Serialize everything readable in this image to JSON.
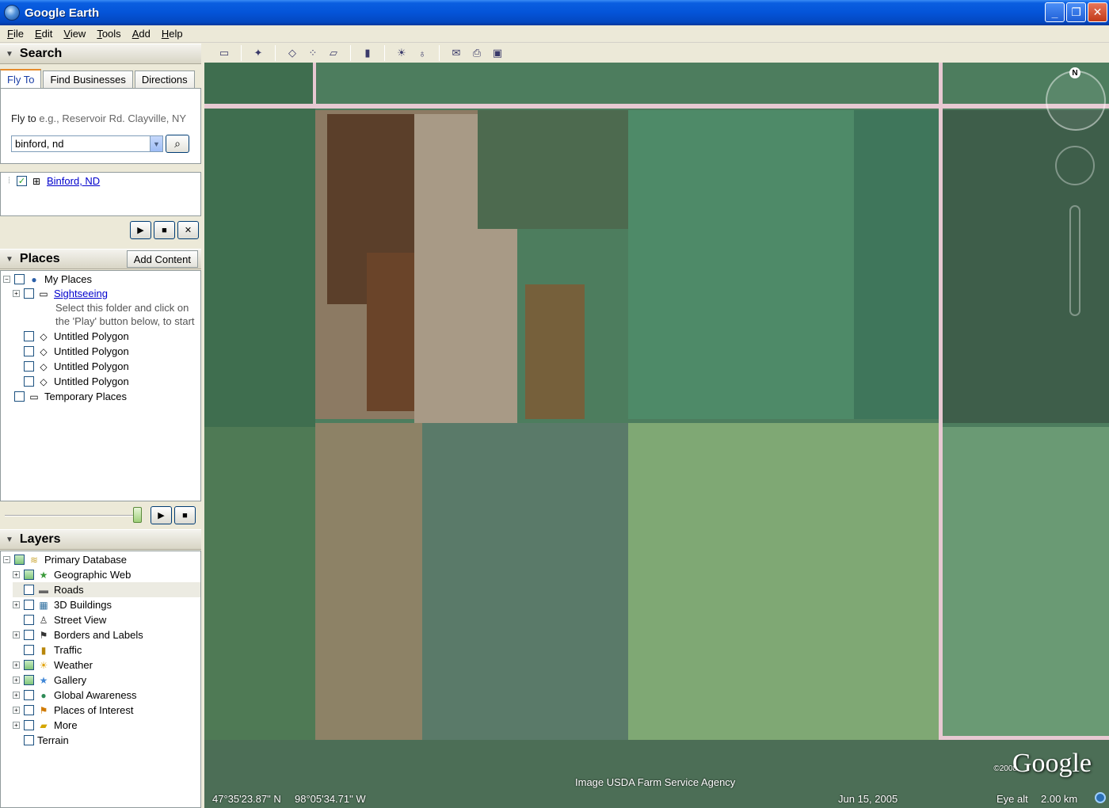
{
  "window": {
    "title": "Google Earth",
    "minimize": "_",
    "maximize": "❐",
    "close": "✕"
  },
  "menu": [
    "File",
    "Edit",
    "View",
    "Tools",
    "Add",
    "Help"
  ],
  "search": {
    "header": "Search",
    "tabs": [
      "Fly To",
      "Find Businesses",
      "Directions"
    ],
    "fly_label": "Fly to",
    "fly_hint": "e.g., Reservoir Rd. Clayville, NY",
    "query": "binford, nd",
    "result": "Binford, ND"
  },
  "places": {
    "header": "Places",
    "add_content": "Add Content",
    "my_places": "My Places",
    "sightseeing": "Sightseeing",
    "sightseeing_desc_1": "Select this folder and click on",
    "sightseeing_desc_2": "the 'Play' button below, to start",
    "polygons": [
      "Untitled Polygon",
      "Untitled Polygon",
      "Untitled Polygon",
      "Untitled Polygon"
    ],
    "temporary": "Temporary Places"
  },
  "layers": {
    "header": "Layers",
    "items": [
      "Primary Database",
      "Geographic Web",
      "Roads",
      "3D Buildings",
      "Street View",
      "Borders and Labels",
      "Traffic",
      "Weather",
      "Gallery",
      "Global Awareness",
      "Places of Interest",
      "More",
      "Terrain"
    ]
  },
  "map": {
    "attribution": "Image USDA Farm Service Agency",
    "lat": "47°35'23.87\" N",
    "lon": "98°05'34.71\" W",
    "date": "Jun 15, 2005",
    "eye_alt_label": "Eye alt",
    "eye_alt": "2.00 km",
    "logo": "Google",
    "logo_year": "©2008",
    "compass": "N"
  },
  "colors": {
    "titlebar": "#0454d8",
    "panel": "#ece9d8",
    "accent": "#e68b2c",
    "link": "#0000cc"
  }
}
